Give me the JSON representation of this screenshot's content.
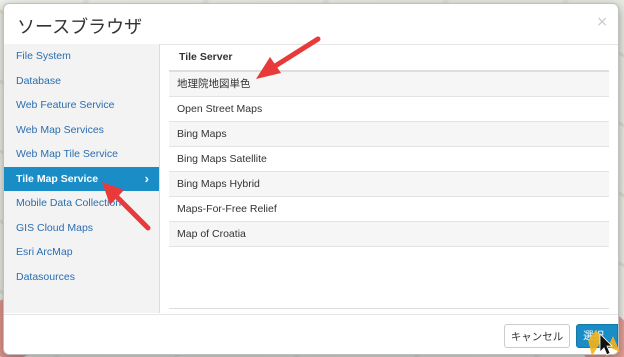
{
  "dialog": {
    "title": "ソースブラウザ",
    "close_glyph": "×"
  },
  "sidebar": {
    "items": [
      {
        "label": "File System"
      },
      {
        "label": "Database"
      },
      {
        "label": "Web Feature Service"
      },
      {
        "label": "Web Map Services"
      },
      {
        "label": "Web Map Tile Service"
      },
      {
        "label": "Tile Map Service",
        "active": true
      },
      {
        "label": "Mobile Data Collection"
      },
      {
        "label": "GIS Cloud Maps"
      },
      {
        "label": "Esri ArcMap"
      },
      {
        "label": "Datasources"
      }
    ],
    "active_chevron": "›"
  },
  "table": {
    "header": "Tile Server",
    "rows": [
      "地理院地図単色",
      "Open Street Maps",
      "Bing Maps",
      "Bing Maps Satellite",
      "Bing Maps Hybrid",
      "Maps-For-Free Relief",
      "Map of Croatia"
    ]
  },
  "footer": {
    "cancel_label": "キャンセル",
    "select_label": "選択"
  },
  "colors": {
    "accent": "#1a8dc6",
    "annotation_arrow": "#e83a3a"
  },
  "icons": {
    "close": "close-icon",
    "chevron": "chevron-right-icon",
    "cursor": "mouse-cursor-icon"
  }
}
